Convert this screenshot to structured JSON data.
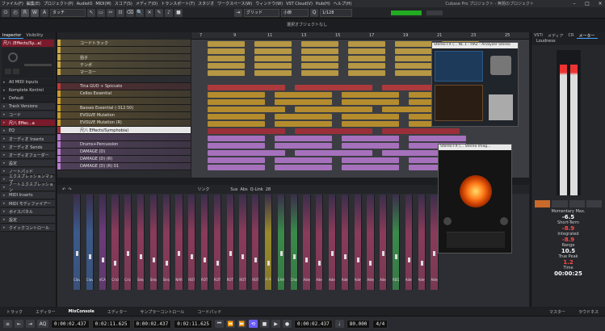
{
  "menu": [
    "ファイル(F)",
    "編集(E)",
    "プロジェクト(P)",
    "AudioIO",
    "MIDI(M)",
    "スコア(S)",
    "メディア(D)",
    "トランスポート(T)",
    "スタジオ",
    "ワークスペース(W)",
    "ウィンドウ(W)",
    "VST Cloud(V)",
    "Hub(H)",
    "ヘルプ(H)"
  ],
  "window_title": "Cubase Pro プロジェクト - 無題のプロジェクト",
  "toolbar": {
    "mode_letters": [
      "R",
      "W",
      "A"
    ],
    "snap_label": "タッチ",
    "grid_label": "グリッド",
    "quant_label": "小節",
    "quant_value": "1/128"
  },
  "status_line": "選択オブジェクトなし",
  "inspector": {
    "tabs": [
      "Inspector",
      "Visibility"
    ],
    "track_title": "尺八 (Effects/Sy...a)",
    "fields": [
      "All MIDI Inputs",
      "Komplete Kontrol",
      "Default"
    ],
    "sections": [
      "Track Versions",
      "コード",
      "尺八 Effec...a",
      "EQ",
      "オーディオ Inserts",
      "オーディオ Sends",
      "オーディオフェーダー",
      "設定",
      "ノートパッド",
      "エクスプレッションマップ",
      "ノートエクスプレッション",
      "MIDI Inserts",
      "MIDI モディファイアー",
      "ボイスパネル",
      "設定",
      "クイックコントロール"
    ],
    "red_sections": [
      2
    ]
  },
  "tracks": [
    {
      "name": "コードトラック",
      "color": "#caa744"
    },
    {
      "name": "",
      "color": "#caa744"
    },
    {
      "name": "拍子",
      "color": "#caa744"
    },
    {
      "name": "テンポ",
      "color": "#caa744"
    },
    {
      "name": "マーカー",
      "color": "#caa744"
    },
    {
      "name": "",
      "color": "#2f3034"
    },
    {
      "name": "Tina GUO + Spiccato",
      "color": "#c0393b"
    },
    {
      "name": "Cellos Essential",
      "color": "#c99a2a"
    },
    {
      "name": "",
      "color": "#c99a2a"
    },
    {
      "name": "Basses Essential (-312:50)",
      "color": "#c99a2a"
    },
    {
      "name": "EVOLVE Mutation",
      "color": "#c99a2a"
    },
    {
      "name": "EVOLVE Mutation (R)",
      "color": "#c99a2a"
    },
    {
      "name": "尺八 Effects/Symphobia)",
      "color": "#9a2f3a",
      "selected": true
    },
    {
      "name": "",
      "color": "#b97ad1"
    },
    {
      "name": "Drums+Percussion",
      "color": "#b97ad1"
    },
    {
      "name": "DAMAGE (D)",
      "color": "#b97ad1"
    },
    {
      "name": "DAMAGE (D) (R)",
      "color": "#b97ad1"
    },
    {
      "name": "DAMAGE (D) (R) 01",
      "color": "#b97ad1"
    }
  ],
  "ruler": [
    "7",
    "9",
    "11",
    "13",
    "15",
    "17",
    "19",
    "21",
    "23",
    "25"
  ],
  "mixer": {
    "toolbar": [
      "リンク",
      "Sus",
      "Abs",
      "Q-Link",
      "28"
    ],
    "channels": [
      "Clavec",
      "Clavec",
      "VCA Lin",
      "Crickt",
      "Crickt",
      "Sleigh B",
      "Sleigh B",
      "Sleigh B",
      "NARK 1",
      "ROTO",
      "ROTO",
      "ROTO",
      "ROTO",
      "ROTO",
      "ROTO",
      "エス婆",
      "EXHALE",
      "Choir A",
      "Adey Cl",
      "Adey Cl",
      "Adey Cl",
      "Adey Cl",
      "Adey Cl",
      "Adey Cl",
      "Adey Cl",
      "REQUIE",
      "Adey Cl",
      "Adey Cl",
      "Adey Cl"
    ],
    "numbers": [
      "36",
      "37",
      "38",
      "39",
      "40",
      "41",
      "42",
      "43",
      "44",
      "45",
      "46",
      "47",
      "48",
      "49",
      "50",
      "51",
      "52",
      "53",
      "54",
      "55",
      "56",
      "57",
      "58",
      "59",
      "60"
    ]
  },
  "plugins": {
    "analyzer_title": "Stereo FX (... NL 1 - HA2 - Analyzer Stereo",
    "imager_title": "Stereo FX (... Stereo Imag..."
  },
  "right": {
    "tabs": [
      "VSTi",
      "メディア",
      "CR",
      "メーター"
    ],
    "loudness_label": "Loudness",
    "momentary_label": "Momentary Max.",
    "momentary_value": "-6.5",
    "short_label": "Short-Term",
    "short_value": "-8.9",
    "integrated_label": "Integrated",
    "integrated_value": "-8.9",
    "range_label": "Range",
    "range_value": "10.5",
    "truepeak_label": "True Peak",
    "truepeak_value": "1.2",
    "time_label": "Time",
    "time_value": "00:00:25"
  },
  "bottom_tabs": [
    "トラック",
    "エディター",
    "MixConsole",
    "エディター",
    "サンプラーコントロール",
    "コードパッド",
    "マスター",
    "ラウドネス"
  ],
  "transport": {
    "aq": "AQ",
    "pos_left": "0:00:02.437",
    "pos_right": "0:02:11.625",
    "pos_main": "0:00:02.437",
    "pos_main2": "0:02:11.625",
    "pos_end": "0:00:02.437",
    "tempo": "80.000",
    "signature": "4/4"
  },
  "colors": {
    "accent": "#4aa3ff",
    "track_red": "#7a1a2a",
    "selected_track": "#e6e6e6",
    "transport_lit": "#6a5cff"
  }
}
